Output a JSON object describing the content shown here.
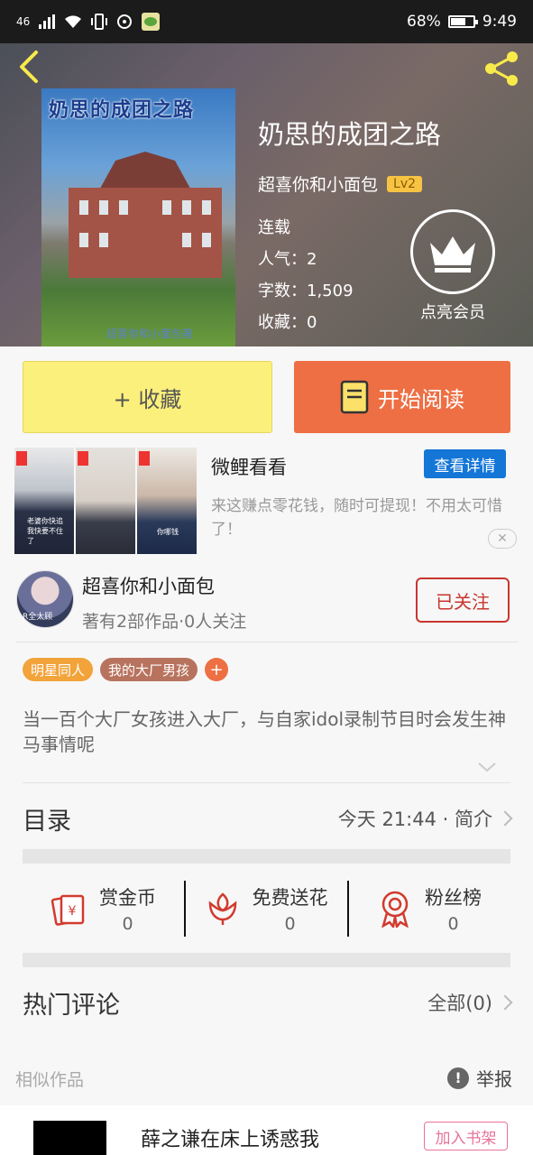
{
  "status_bar": {
    "signal": "46",
    "battery": "68%",
    "time": "9:49"
  },
  "book": {
    "cover_title": "奶思的成团之路",
    "cover_author": "超喜你和小面包著",
    "title": "奶思的成团之路",
    "author": "超喜你和小面包",
    "level": "Lv2",
    "status": "连载",
    "popularity": "人气：2",
    "word_count": "字数：1,509",
    "favorites": "收藏：0"
  },
  "vip": {
    "label": "点亮会员"
  },
  "actions": {
    "favorite_label": "+ 收藏",
    "read_label": "开始阅读"
  },
  "ad": {
    "title": "微鲤看看",
    "button": "查看详情",
    "description": "来这赚点零花钱，随时可提现！不用太可惜了！",
    "thumb1_caption": "老婆你快追我快要不住了",
    "thumb3_caption": "你哪钱",
    "close": "✕"
  },
  "author_card": {
    "name": "超喜你和小面包",
    "stats": "著有2部作品·0人关注",
    "follow_label": "已关注",
    "avatar_caption": "R全太顾"
  },
  "tags": [
    "明星同人",
    "我的大厂男孩"
  ],
  "tag_add": "+",
  "synopsis": "当一百个大厂女孩进入大厂，与自家idol录制节目时会发生神马事情呢",
  "catalog": {
    "title": "目录",
    "right": "今天 21:44 · 简介"
  },
  "stats": [
    {
      "label": "赏金币",
      "value": "0"
    },
    {
      "label": "免费送花",
      "value": "0"
    },
    {
      "label": "粉丝榜",
      "value": "0"
    }
  ],
  "comments": {
    "title": "热门评论",
    "right": "全部(0)"
  },
  "similar": {
    "label": "相似作品",
    "report": "举报"
  },
  "recommend": {
    "title": "薛之谦在床上诱惑我",
    "add_label": "加入书架"
  }
}
